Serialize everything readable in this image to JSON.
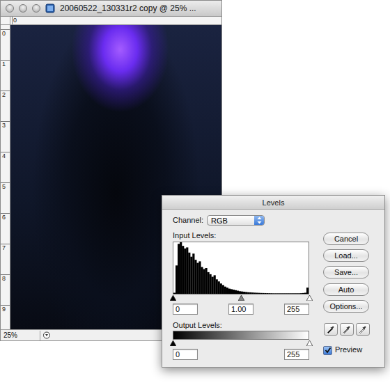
{
  "document": {
    "title": "20060522_130331r2 copy @ 25% ...",
    "zoom": "25%",
    "ruler_top": [
      "0"
    ],
    "ruler_left": [
      "0",
      "1",
      "2",
      "3",
      "4",
      "5",
      "6",
      "7",
      "8",
      "9"
    ]
  },
  "dialog": {
    "title": "Levels",
    "channel_label": "Channel:",
    "channel": "RGB",
    "input_label": "Input Levels:",
    "histogram": [
      0.02,
      0.55,
      0.97,
      1,
      0.93,
      0.88,
      0.9,
      0.8,
      0.72,
      0.78,
      0.66,
      0.6,
      0.63,
      0.52,
      0.48,
      0.5,
      0.42,
      0.38,
      0.33,
      0.36,
      0.28,
      0.24,
      0.2,
      0.17,
      0.14,
      0.12,
      0.1,
      0.09,
      0.08,
      0.07,
      0.06,
      0.05,
      0.045,
      0.04,
      0.035,
      0.03,
      0.028,
      0.025,
      0.022,
      0.02,
      0.018,
      0.016,
      0.015,
      0.014,
      0.013,
      0.012,
      0.011,
      0.01,
      0.01,
      0.01,
      0.01,
      0.01,
      0.01,
      0.01,
      0.01,
      0.01,
      0.01,
      0.01,
      0.01,
      0.01,
      0.012,
      0.015,
      0.02,
      0.12
    ],
    "input_sliders": [
      {
        "level": 0,
        "color": "#000000"
      },
      {
        "level": 0.5,
        "color": "#888888"
      },
      {
        "level": 1,
        "color": "#ffffff"
      }
    ],
    "input_fields": [
      "0",
      "1.00",
      "255"
    ],
    "output_label": "Output Levels:",
    "output_sliders": [
      {
        "level": 0,
        "color": "#000000"
      },
      {
        "level": 1,
        "color": "#ffffff"
      }
    ],
    "output_fields": [
      "0",
      "255"
    ],
    "buttons": [
      "Cancel",
      "Load...",
      "Save...",
      "Auto",
      "Options..."
    ],
    "eyedroppers": [
      {
        "color": "#000000"
      },
      {
        "color": "#888888"
      },
      {
        "color": "#ffffff"
      }
    ],
    "preview": {
      "label": "Preview",
      "checked": true
    }
  }
}
